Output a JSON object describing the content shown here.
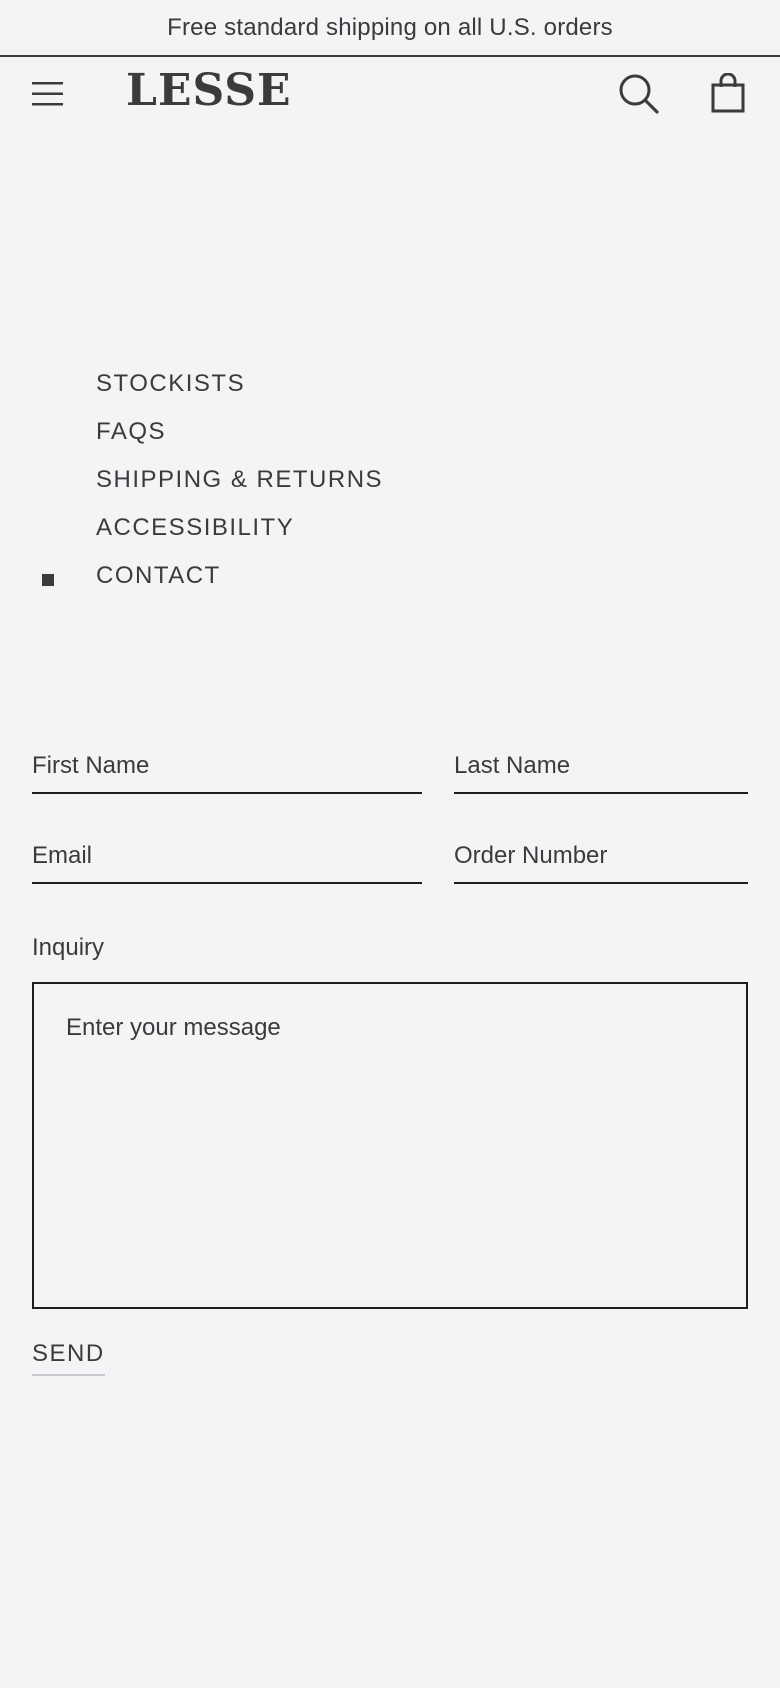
{
  "announcement": {
    "text": "Free standard shipping on all U.S. orders"
  },
  "header": {
    "logo": "LESSE",
    "menu_icon": "hamburger-menu-icon",
    "search_icon": "search-icon",
    "cart_icon": "shopping-bag-icon"
  },
  "subnav": {
    "items": [
      {
        "label": "STOCKISTS",
        "active": false
      },
      {
        "label": "FAQS",
        "active": false
      },
      {
        "label": "SHIPPING & RETURNS",
        "active": false
      },
      {
        "label": "ACCESSIBILITY",
        "active": false
      },
      {
        "label": "CONTACT",
        "active": true
      }
    ]
  },
  "form": {
    "first_name": {
      "placeholder": "First Name",
      "value": ""
    },
    "last_name": {
      "placeholder": "Last Name",
      "value": ""
    },
    "email": {
      "placeholder": "Email",
      "value": ""
    },
    "order_number": {
      "placeholder": "Order Number",
      "value": ""
    },
    "inquiry_label": "Inquiry",
    "message": {
      "placeholder": "Enter your message",
      "value": ""
    },
    "send_label": "SEND"
  },
  "colors": {
    "background": "#f3f4f6",
    "text": "#3b3b3d",
    "border": "#1e1e1e"
  }
}
